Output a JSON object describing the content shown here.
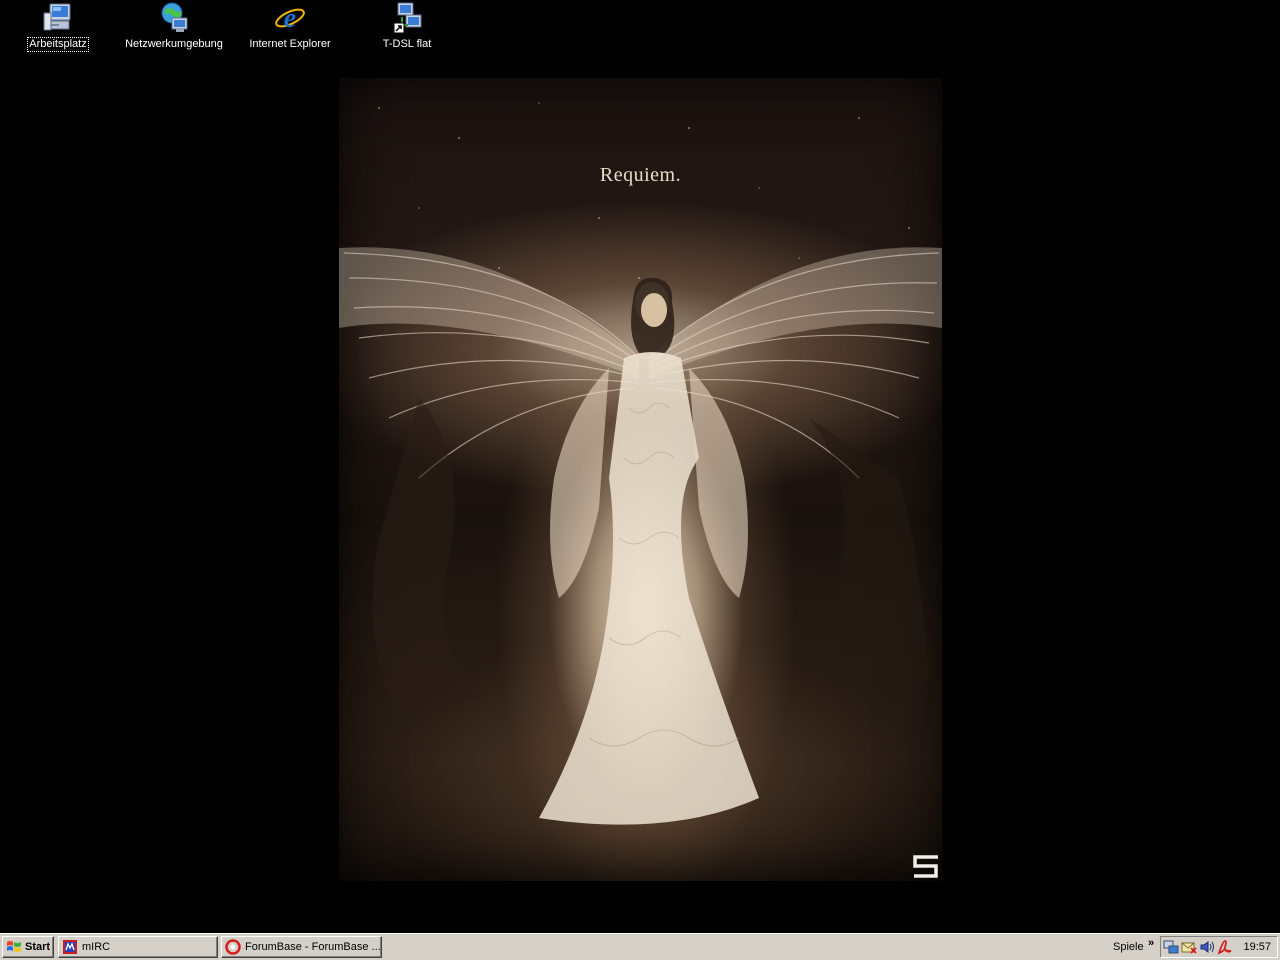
{
  "desktop": {
    "icons": [
      {
        "label": "Arbeitsplatz",
        "icon": "my-computer-icon",
        "selected": true
      },
      {
        "label": "Netzwerkumgebung",
        "icon": "network-places-icon",
        "selected": false
      },
      {
        "label": "Internet Explorer",
        "icon": "internet-explorer-icon",
        "selected": false
      },
      {
        "label": "T-DSL flat",
        "icon": "dialup-connection-shortcut-icon",
        "selected": false
      }
    ],
    "wallpaper": {
      "title": "Requiem.",
      "logo": "5",
      "background_color": "#000000"
    }
  },
  "taskbar": {
    "start_label": "Start",
    "tasks": [
      {
        "label": "mIRC",
        "icon": "mirc-icon"
      },
      {
        "label": "ForumBase - ForumBase ...",
        "icon": "opera-icon"
      }
    ],
    "toolbar_label": "Spiele",
    "chevron": "»",
    "tray_icons": [
      "network-tray-icon",
      "mail-tray-icon",
      "volume-tray-icon",
      "acrobat-tray-icon"
    ],
    "clock": "19:57"
  },
  "colors": {
    "taskbar_bg": "#d4d0c8",
    "desktop_bg": "#000000"
  }
}
